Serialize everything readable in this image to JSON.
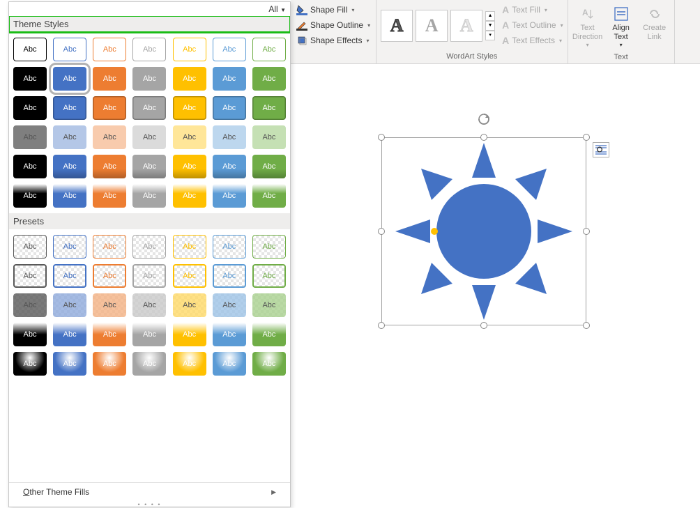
{
  "ribbon": {
    "shapeFill": "Shape Fill",
    "shapeOutline": "Shape Outline",
    "shapeEffects": "Shape Effects",
    "wordartGroupLabel": "WordArt Styles",
    "textFill": "Text Fill",
    "textOutline": "Text Outline",
    "textEffects": "Text Effects",
    "textDirection": "Text Direction",
    "alignText": "Align Text",
    "createLink": "Create Link",
    "textGroupLabel": "Text",
    "waSample": "A"
  },
  "gallery": {
    "allLabel": "All",
    "themeHeader": "Theme Styles",
    "presetsHeader": "Presets",
    "swatchLabel": "Abc",
    "footer": "Other Theme Fills",
    "themeRows": [
      {
        "type": "outline",
        "colors": [
          "#000000",
          "#4472c4",
          "#ed7d31",
          "#a5a5a5",
          "#ffc000",
          "#5b9bd5",
          "#70ad47"
        ]
      },
      {
        "type": "solid",
        "colors": [
          "#000000",
          "#4472c4",
          "#ed7d31",
          "#a5a5a5",
          "#ffc000",
          "#5b9bd5",
          "#70ad47"
        ],
        "selectedIndex": 1
      },
      {
        "type": "solid-dark",
        "colors": [
          "#000000",
          "#4472c4",
          "#ed7d31",
          "#a5a5a5",
          "#ffc000",
          "#5b9bd5",
          "#70ad47"
        ]
      },
      {
        "type": "light",
        "colors": [
          "#7f7f7f",
          "#b4c7e7",
          "#f8cbad",
          "#dbdbdb",
          "#ffe699",
          "#bdd7ee",
          "#c5e0b4"
        ]
      },
      {
        "type": "solid-grad",
        "colors": [
          "#000000",
          "#4472c4",
          "#ed7d31",
          "#a5a5a5",
          "#ffc000",
          "#5b9bd5",
          "#70ad47"
        ]
      },
      {
        "type": "solid-bevel",
        "colors": [
          "#000000",
          "#4472c4",
          "#ed7d31",
          "#a5a5a5",
          "#ffc000",
          "#5b9bd5",
          "#70ad47"
        ]
      }
    ],
    "presetRows": [
      {
        "type": "trans-outline",
        "colors": [
          "#595959",
          "#4472c4",
          "#ed7d31",
          "#a5a5a5",
          "#ffc000",
          "#5b9bd5",
          "#70ad47"
        ]
      },
      {
        "type": "trans-outline-thick",
        "colors": [
          "#595959",
          "#4472c4",
          "#ed7d31",
          "#a5a5a5",
          "#ffc000",
          "#5b9bd5",
          "#70ad47"
        ]
      },
      {
        "type": "semi",
        "colors": [
          "#595959",
          "#8faadc",
          "#f4b183",
          "#c9c9c9",
          "#ffd966",
          "#9dc3e6",
          "#a9d18e"
        ]
      },
      {
        "type": "gloss",
        "colors": [
          "#000000",
          "#4472c4",
          "#ed7d31",
          "#a5a5a5",
          "#ffc000",
          "#5b9bd5",
          "#70ad47"
        ]
      },
      {
        "type": "gloss-grad",
        "colors": [
          "#000000",
          "#4472c4",
          "#ed7d31",
          "#a5a5a5",
          "#ffc000",
          "#5b9bd5",
          "#70ad47"
        ]
      }
    ]
  },
  "shape": {
    "fill": "#4472c4"
  }
}
